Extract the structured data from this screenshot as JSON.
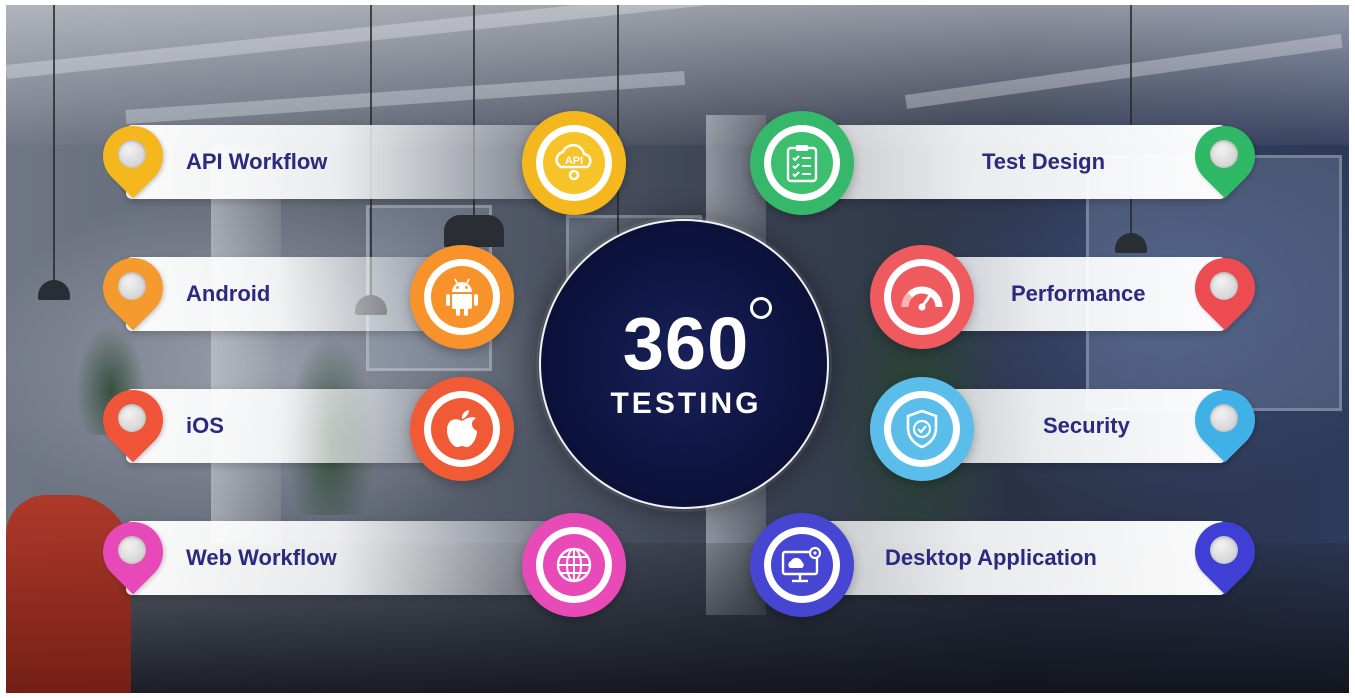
{
  "center": {
    "number": "360",
    "subtitle": "TESTING"
  },
  "left_items": [
    {
      "label": "API Workflow",
      "pin_color": "#f4b81e",
      "ring_color": "#f4b81e",
      "core_color": "#f6c329",
      "icon": "api-cloud-gear-icon",
      "icon_text": "API"
    },
    {
      "label": "Android",
      "pin_color": "#f59a2c",
      "ring_color": "#f7932a",
      "core_color": "#f7932a",
      "icon": "android-icon"
    },
    {
      "label": "iOS",
      "pin_color": "#f0553a",
      "ring_color": "#f05a35",
      "core_color": "#f05a35",
      "icon": "apple-icon"
    },
    {
      "label": "Web Workflow",
      "pin_color": "#e849b8",
      "ring_color": "#e84bb8",
      "core_color": "#e84bb8",
      "icon": "globe-icon"
    }
  ],
  "right_items": [
    {
      "label": "Test Design",
      "pin_color": "#2fb866",
      "ring_color": "#35b86a",
      "core_color": "#3cc070",
      "icon": "clipboard-checklist-icon"
    },
    {
      "label": "Performance",
      "pin_color": "#ec4b52",
      "ring_color": "#ef5a5f",
      "core_color": "#ef5a5f",
      "icon": "speedometer-icon"
    },
    {
      "label": "Security",
      "pin_color": "#3fb1e6",
      "ring_color": "#5bbde9",
      "core_color": "#5bbde9",
      "icon": "shield-check-icon"
    },
    {
      "label": "Desktop Application",
      "pin_color": "#3f3fd6",
      "ring_color": "#4646d2",
      "core_color": "#4646d2",
      "icon": "desktop-cloud-gear-icon"
    }
  ]
}
